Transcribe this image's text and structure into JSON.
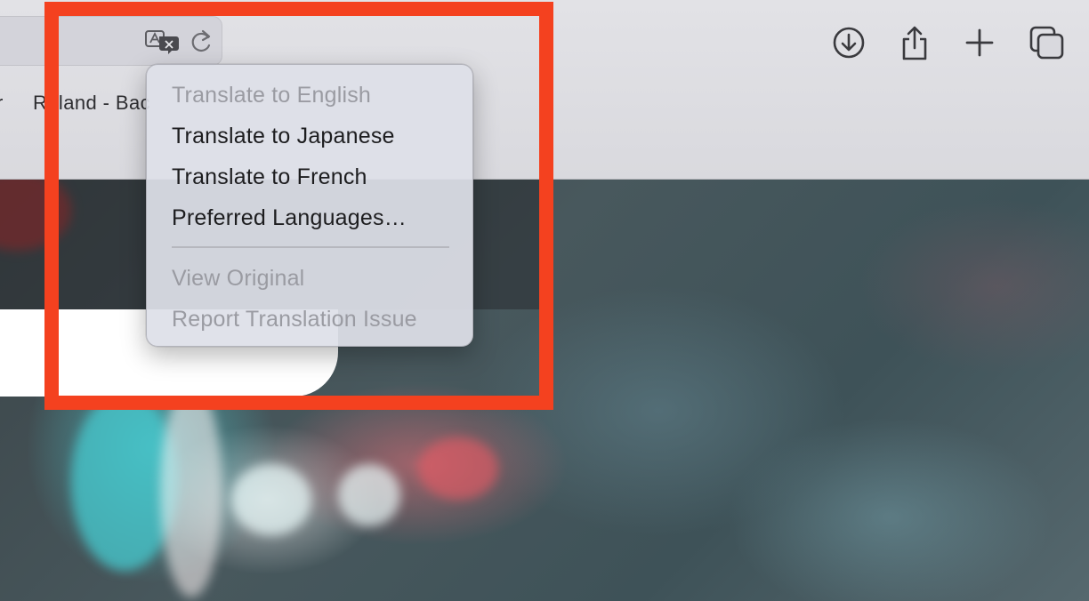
{
  "window": {
    "title": ""
  },
  "toolbar": {
    "translate_icon": "translate-icon",
    "reload_icon": "reload-icon",
    "download_icon": "download-icon",
    "share_icon": "share-icon",
    "new_tab_icon": "plus-icon",
    "tab_overview_icon": "tab-overview-icon"
  },
  "bookmarks": {
    "items": [
      {
        "label": "r"
      },
      {
        "label": "Roland - Bac"
      }
    ]
  },
  "translate_menu": {
    "items": [
      {
        "label": "Translate to English",
        "enabled": false
      },
      {
        "label": "Translate to Japanese",
        "enabled": true
      },
      {
        "label": "Translate to French",
        "enabled": true
      },
      {
        "label": "Preferred Languages…",
        "enabled": true
      }
    ],
    "secondary_items": [
      {
        "label": "View Original",
        "enabled": false
      },
      {
        "label": "Report Translation Issue",
        "enabled": false
      }
    ]
  },
  "colors": {
    "highlight": "#f4411f",
    "menu_bg": "#dee0e8",
    "disabled_text": "#9a9ba2",
    "enabled_text": "#1d1d1f"
  }
}
